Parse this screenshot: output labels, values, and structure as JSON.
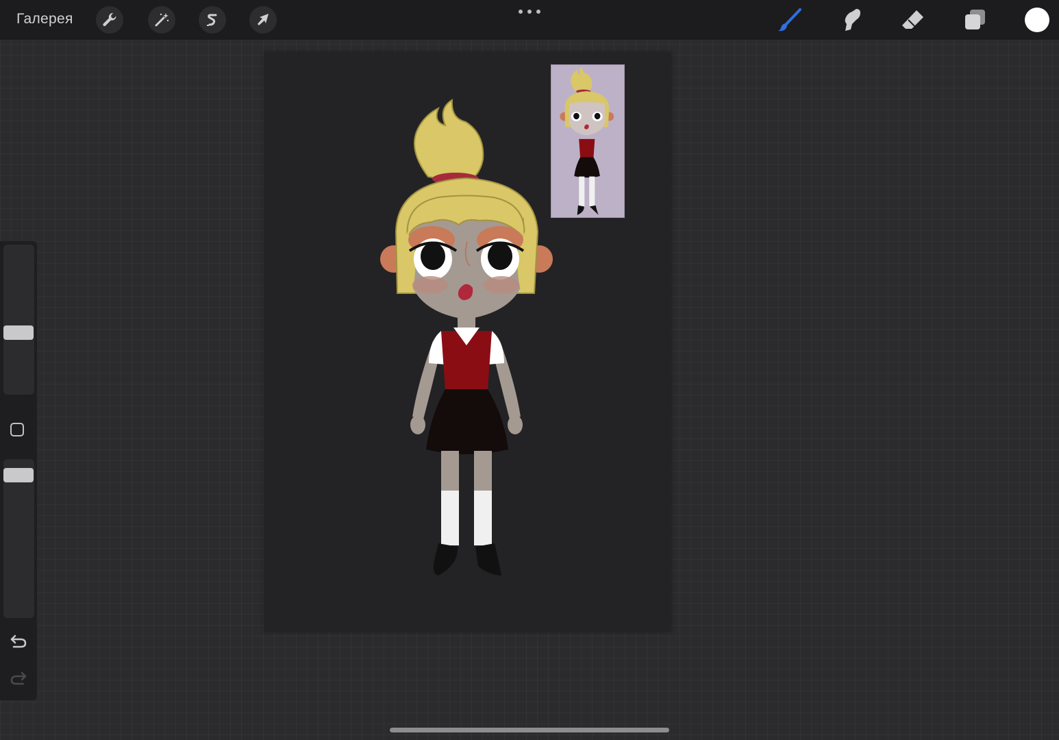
{
  "app": {
    "gallery_label": "Галерея"
  },
  "toolbar_left": {
    "actions_icon": "wrench-icon",
    "adjustments_icon": "magic-wand-icon",
    "selection_icon": "selection-s-icon",
    "transform_icon": "arrow-cursor-icon"
  },
  "toolbar_center": {
    "more_icon": "ellipsis-icon"
  },
  "toolbar_right": {
    "brush_icon": "brush-icon",
    "smudge_icon": "smudge-finger-icon",
    "eraser_icon": "eraser-icon",
    "layers_icon": "layers-icon",
    "active_color": "#ffffff",
    "brush_active_color": "#2f6fe0"
  },
  "sidebar": {
    "brush_size_icon": "size-slider",
    "modify_icon": "square-modifier-icon",
    "opacity_icon": "opacity-slider",
    "undo_icon": "undo-icon",
    "redo_icon": "redo-icon"
  },
  "canvas": {
    "background": "#232325"
  },
  "reference": {
    "background": "#bdb1c7"
  }
}
